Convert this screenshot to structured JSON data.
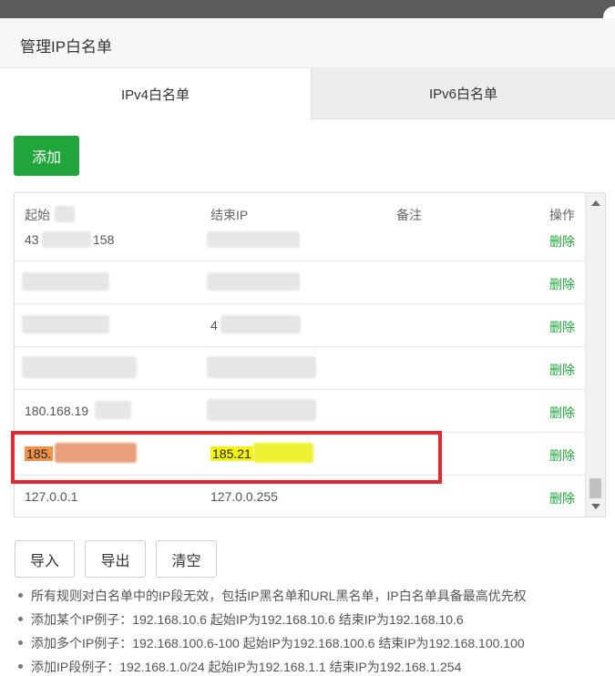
{
  "dialog": {
    "title": "管理IP白名单"
  },
  "tabs": [
    {
      "label": "IPv4白名单",
      "active": true
    },
    {
      "label": "IPv6白名单",
      "active": false
    }
  ],
  "toolbar": {
    "add_label": "添加"
  },
  "table": {
    "columns": {
      "start": "起始",
      "end": "结束IP",
      "note": "备注",
      "op": "操作"
    },
    "rows": [
      {
        "start": "43",
        "start_suffix": "158",
        "end": "",
        "note": "",
        "op": "删除"
      },
      {
        "start": "",
        "end": "",
        "note": "",
        "op": "删除"
      },
      {
        "start": "",
        "end": "4",
        "note": "",
        "op": "删除"
      },
      {
        "start": "",
        "end": "",
        "note": "",
        "op": "删除"
      },
      {
        "start": "180.168.19",
        "end": "",
        "note": "",
        "op": "删除"
      },
      {
        "start": "185.",
        "end": "185.21",
        "note": "",
        "op": "删除"
      },
      {
        "start": "127.0.0.1",
        "end": "127.0.0.255",
        "note": "",
        "op": "删除"
      }
    ]
  },
  "actions": {
    "import": "导入",
    "export": "导出",
    "clear": "清空"
  },
  "tips": [
    "所有规则对白名单中的IP段无效，包括IP黑名单和URL黑名单，IP白名单具备最高优先权",
    "添加某个IP例子：192.168.10.6 起始IP为192.168.10.6 结束IP为192.168.10.6",
    "添加多个IP例子：192.168.100.6-100 起始IP为192.168.100.6 结束IP为192.168.100.100",
    "添加IP段例子：192.168.1.0/24 起始IP为192.168.1.1 结束IP为192.168.1.254"
  ],
  "colors": {
    "accent": "#20a53a",
    "highlight_frame": "#e8262d",
    "highlight_orange": "#f0924a",
    "highlight_yellow": "#f5f513"
  }
}
